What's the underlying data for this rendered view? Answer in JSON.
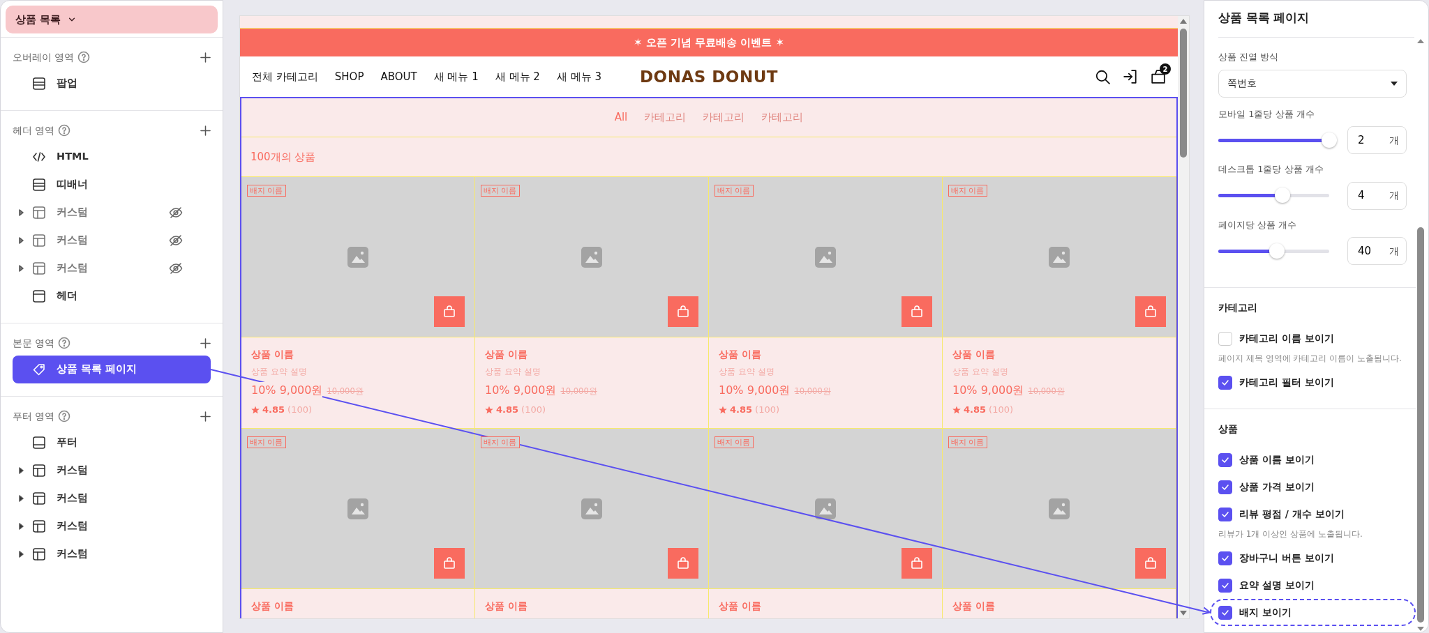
{
  "page_selector": {
    "label": "상품 목록"
  },
  "sections": [
    {
      "title": "오버레이 영역",
      "items": [
        {
          "kind": "banner",
          "label": "팝업",
          "expandable": false,
          "hidden": false,
          "selected": false
        }
      ]
    },
    {
      "title": "헤더 영역",
      "items": [
        {
          "kind": "code",
          "label": "HTML",
          "expandable": false,
          "hidden": false,
          "selected": false
        },
        {
          "kind": "banner",
          "label": "띠배너",
          "expandable": false,
          "hidden": false,
          "selected": false
        },
        {
          "kind": "custom",
          "label": "커스텀",
          "expandable": true,
          "hidden": true,
          "selected": false
        },
        {
          "kind": "custom",
          "label": "커스텀",
          "expandable": true,
          "hidden": true,
          "selected": false
        },
        {
          "kind": "custom",
          "label": "커스텀",
          "expandable": true,
          "hidden": true,
          "selected": false
        },
        {
          "kind": "header",
          "label": "헤더",
          "expandable": false,
          "hidden": false,
          "selected": false
        }
      ]
    },
    {
      "title": "본문 영역",
      "items": [
        {
          "kind": "page",
          "label": "상품 목록 페이지",
          "expandable": false,
          "hidden": false,
          "selected": true
        }
      ]
    },
    {
      "title": "푸터 영역",
      "items": [
        {
          "kind": "footer",
          "label": "푸터",
          "expandable": false,
          "hidden": false,
          "selected": false
        },
        {
          "kind": "custom",
          "label": "커스텀",
          "expandable": true,
          "hidden": false,
          "selected": false
        },
        {
          "kind": "custom",
          "label": "커스텀",
          "expandable": true,
          "hidden": false,
          "selected": false
        },
        {
          "kind": "custom",
          "label": "커스텀",
          "expandable": true,
          "hidden": false,
          "selected": false
        },
        {
          "kind": "custom",
          "label": "커스텀",
          "expandable": true,
          "hidden": false,
          "selected": false
        }
      ]
    }
  ],
  "preview": {
    "banner": "✶ 오픈 기념 무료배송 이벤트 ✶",
    "nav": [
      "전체 카테고리",
      "SHOP",
      "ABOUT",
      "새 메뉴 1",
      "새 메뉴 2",
      "새 메뉴 3"
    ],
    "logo": "DONAS DONUT",
    "cart_count": "2",
    "category_tabs": [
      {
        "label": "All",
        "selected": true
      },
      {
        "label": "카테고리",
        "selected": false
      },
      {
        "label": "카테고리",
        "selected": false
      },
      {
        "label": "카테고리",
        "selected": false
      }
    ],
    "count": "100개의 상품",
    "products": [
      {
        "badge": "배지 이름",
        "name": "상품 이름",
        "summary": "상품 요약 설명",
        "discount": "10%",
        "price": "9,000원",
        "original_price": "10,000원",
        "rating": "4.85",
        "review_count": "(100)"
      },
      {
        "badge": "배지 이름",
        "name": "상품 이름",
        "summary": "상품 요약 설명",
        "discount": "10%",
        "price": "9,000원",
        "original_price": "10,000원",
        "rating": "4.85",
        "review_count": "(100)"
      },
      {
        "badge": "배지 이름",
        "name": "상품 이름",
        "summary": "상품 요약 설명",
        "discount": "10%",
        "price": "9,000원",
        "original_price": "10,000원",
        "rating": "4.85",
        "review_count": "(100)"
      },
      {
        "badge": "배지 이름",
        "name": "상품 이름",
        "summary": "상품 요약 설명",
        "discount": "10%",
        "price": "9,000원",
        "original_price": "10,000원",
        "rating": "4.85",
        "review_count": "(100)"
      },
      {
        "badge": "배지 이름",
        "name": "상품 이름"
      },
      {
        "badge": "배지 이름",
        "name": "상품 이름"
      },
      {
        "badge": "배지 이름",
        "name": "상품 이름"
      },
      {
        "badge": "배지 이름",
        "name": "상품 이름"
      }
    ]
  },
  "settings": {
    "title": "상품 목록 페이지",
    "display": {
      "label": "상품 진열 방식",
      "value": "쪽번호"
    },
    "sliders": [
      {
        "label": "모바일 1줄당 상품 개수",
        "level": 1,
        "value": "2",
        "unit": "개"
      },
      {
        "label": "데스크톱 1줄당 상품 개수",
        "level": 0.58,
        "value": "4",
        "unit": "개"
      },
      {
        "label": "페이지당 상품 개수",
        "level": 0.53,
        "value": "40",
        "unit": "개"
      }
    ],
    "groups": [
      {
        "title": "카테고리",
        "options": [
          {
            "label": "카테고리 이름 보이기",
            "checked": false,
            "highlighted": false,
            "help": "페이지 제목 영역에 카테고리 이름이 노출됩니다."
          },
          {
            "label": "카테고리 필터 보이기",
            "checked": true,
            "highlighted": false
          }
        ]
      },
      {
        "title": "상품",
        "options": [
          {
            "label": "상품 이름 보이기",
            "checked": true,
            "highlighted": false
          },
          {
            "label": "상품 가격 보이기",
            "checked": true,
            "highlighted": false
          },
          {
            "label": "리뷰 평점 / 개수 보이기",
            "checked": true,
            "highlighted": false,
            "help": "리뷰가 1개 이상인 상품에 노출됩니다."
          },
          {
            "label": "장바구니 버튼 보이기",
            "checked": true,
            "highlighted": false
          },
          {
            "label": "요약 설명 보이기",
            "checked": true,
            "highlighted": false
          },
          {
            "label": "배지 보이기",
            "checked": true,
            "highlighted": true
          }
        ]
      }
    ]
  }
}
